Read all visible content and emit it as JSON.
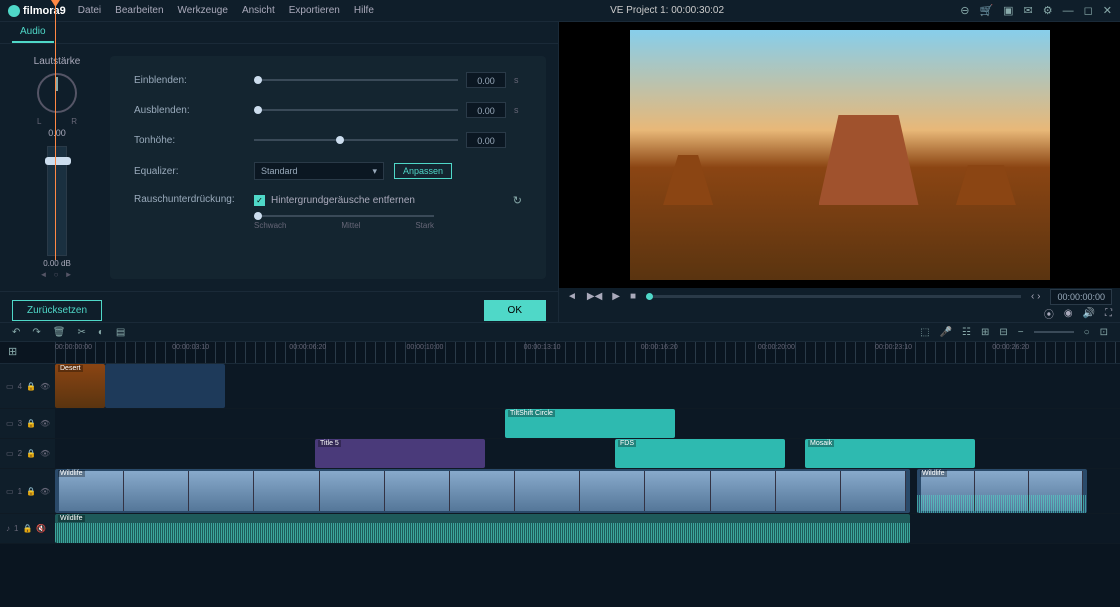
{
  "app": {
    "name": "filmora9"
  },
  "menu": [
    "Datei",
    "Bearbeiten",
    "Werkzeuge",
    "Ansicht",
    "Exportieren",
    "Hilfe"
  ],
  "project_title": "VE Project 1: 00:00:30:02",
  "tab": "Audio",
  "volume": {
    "label": "Lautstärke",
    "lr_l": "L",
    "lr_r": "R",
    "dial_val": "0.00",
    "meter_val": "0.00",
    "meter_unit": "dB",
    "arrows": "◄ ○ ►"
  },
  "settings": {
    "fadein": {
      "label": "Einblenden:",
      "value": "0.00",
      "unit": "s"
    },
    "fadeout": {
      "label": "Ausblenden:",
      "value": "0.00",
      "unit": "s"
    },
    "pitch": {
      "label": "Tonhöhe:",
      "value": "0.00"
    },
    "equalizer": {
      "label": "Equalizer:",
      "value": "Standard",
      "adjust": "Anpassen"
    },
    "noise": {
      "label": "Rauschunterdrückung:",
      "checkbox": "Hintergrundgeräusche entfernen",
      "low": "Schwach",
      "mid": "Mittel",
      "high": "Stark"
    }
  },
  "buttons": {
    "reset": "Zurücksetzen",
    "ok": "OK"
  },
  "playback": {
    "timecode": "00:00:00:00",
    "nav": "‹ ›"
  },
  "ruler": [
    "00:00:00:00",
    "00:00:03:10",
    "00:00:06:20",
    "00:00:10:00",
    "00:00:13:10",
    "00:00:16:20",
    "00:00:20:00",
    "00:00:23:10",
    "00:00:26:20"
  ],
  "tracks": {
    "t4": "4",
    "t3": "3",
    "t2": "2",
    "t1": "1",
    "a1": "1"
  },
  "clips": {
    "desert": "Desert",
    "tilt": "TiltShift Circle",
    "title5": "Title 5",
    "eds": "FDS",
    "mosaic": "Mosaik",
    "wildlife": "Wildlife",
    "wildlife2": "Wildlife"
  }
}
